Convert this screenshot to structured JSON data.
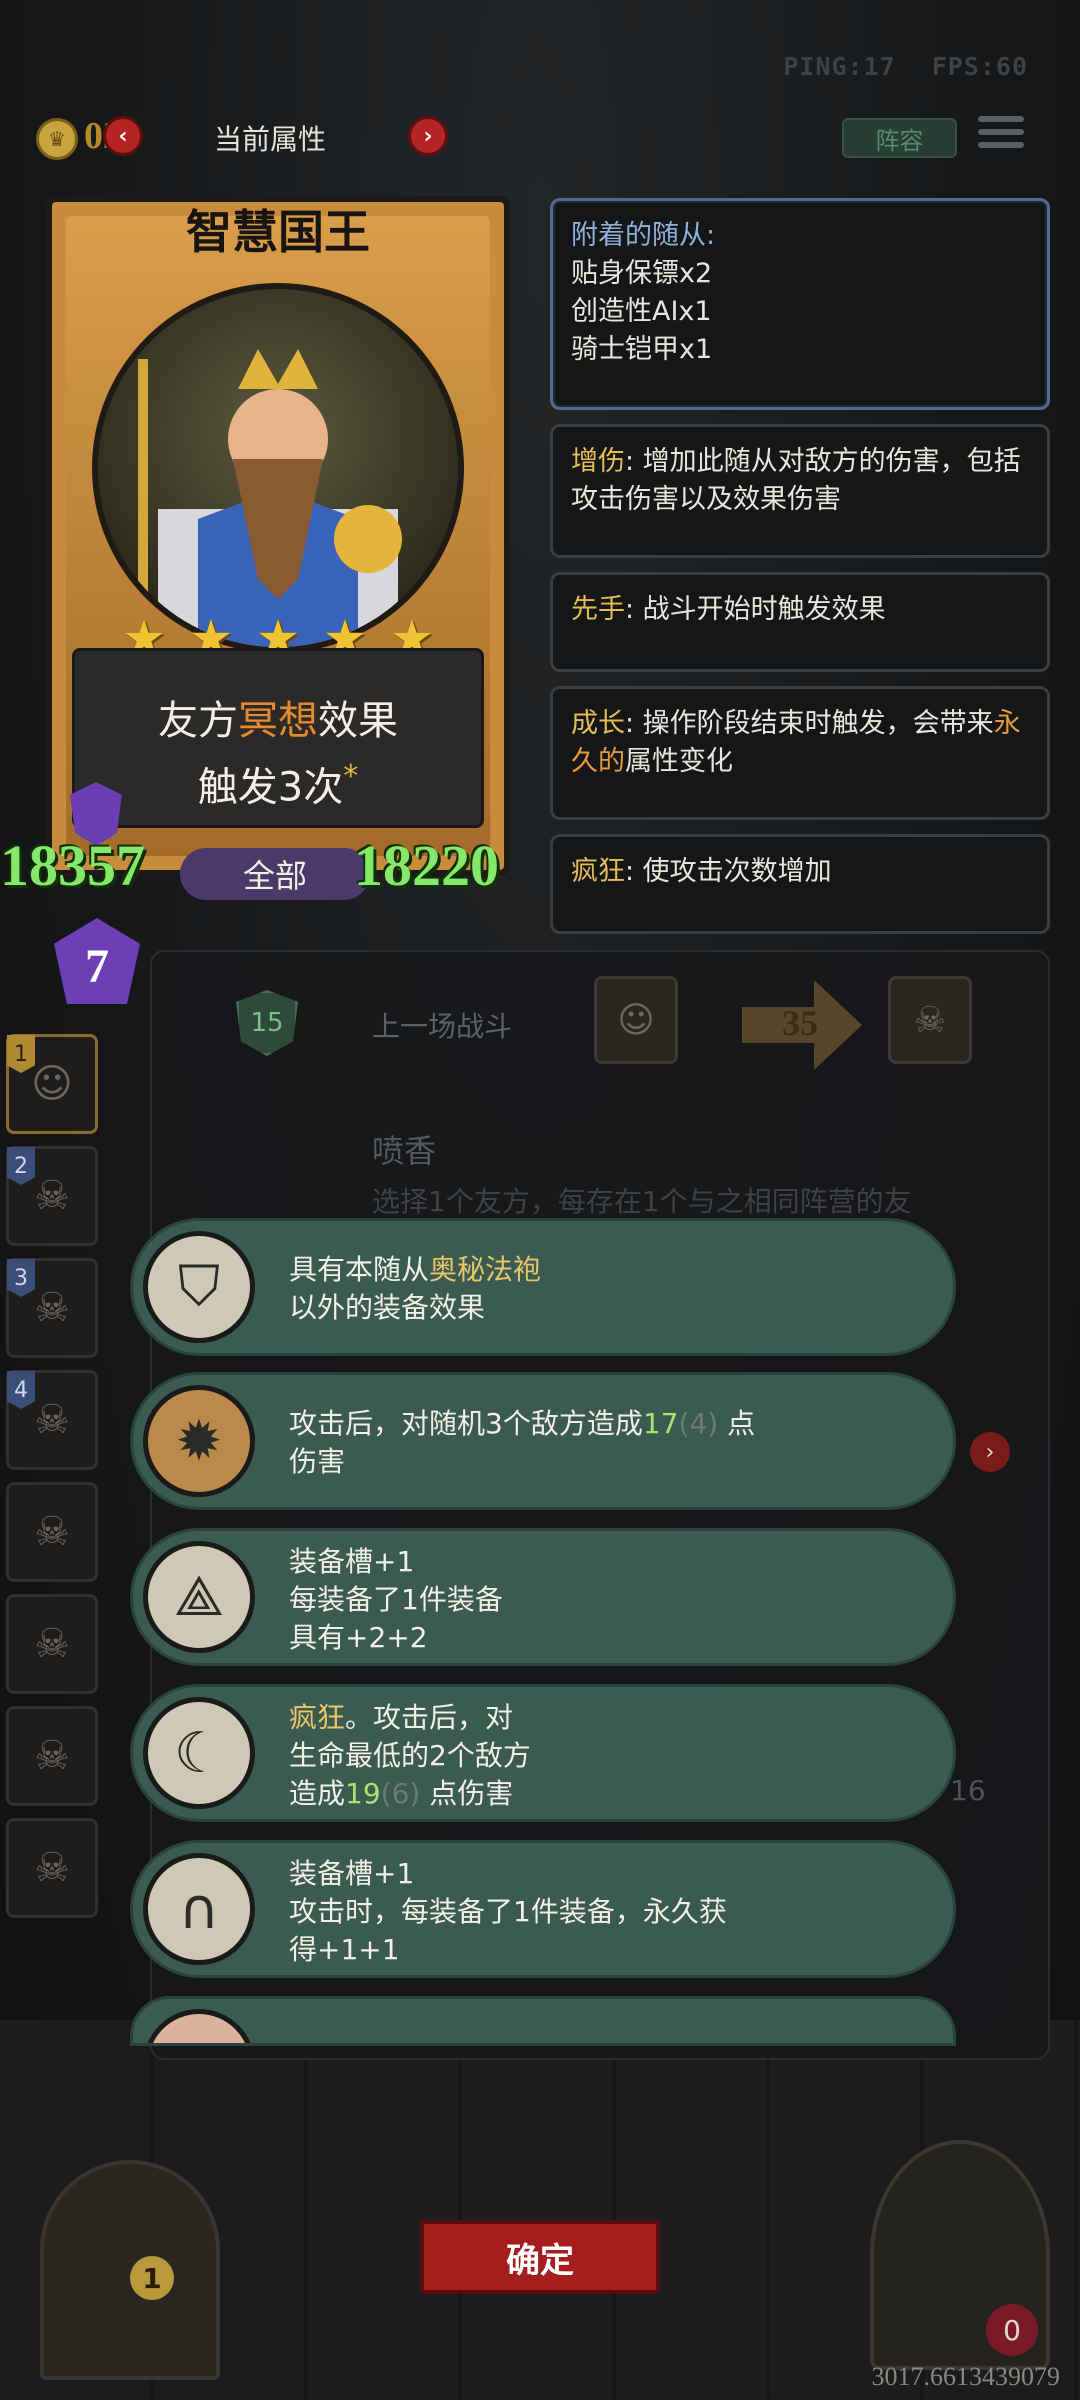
{
  "hud": {
    "ping": "PING:17",
    "fps": "FPS:60",
    "gold": "020",
    "title": "当前属性",
    "lineup_label": "阵容"
  },
  "hero": {
    "name": "智慧国王",
    "stars": 5,
    "effect_line1_a": "友方",
    "effect_line1_hl": "冥想",
    "effect_line1_b": "效果",
    "effect_line2": "触发3次",
    "effect_asterisk": "*",
    "stat_left": "18357",
    "stat_right": "18220",
    "filter_label": "全部",
    "level": "7"
  },
  "tooltips": [
    {
      "title": "附着的随从:",
      "lines": [
        "贴身保镖x2",
        "创造性AIx1",
        "骑士铠甲x1"
      ]
    },
    {
      "key": "增伤",
      "text": ": 增加此随从对敌方的伤害，包括攻击伤害以及效果伤害"
    },
    {
      "key": "先手",
      "text": ": 战斗开始时触发效果"
    },
    {
      "key": "成长",
      "text_a": ": 操作阶段结束时触发，会带来",
      "hl": "永久的",
      "text_b": "属性变化"
    },
    {
      "key": "疯狂",
      "text": ": 使攻击次数增加"
    }
  ],
  "battle": {
    "shield_value": "15",
    "last_battle_label": "上一场战斗",
    "damage": "35",
    "skill_title": "喷香",
    "skill_desc": "选择1个友方，每存在1个与之相同阵营的友"
  },
  "roster_numbers": [
    "1",
    "2",
    "3",
    "4"
  ],
  "equipment": [
    {
      "icon": "robe-icon",
      "line1_a": "具有本随从",
      "line1_hl": "奥秘法袍",
      "line2": "以外的装备效果"
    },
    {
      "icon": "catapult-icon",
      "line1_a": "攻击后，对随机",
      "line1_b": "3",
      "line1_c": "个敌方造成",
      "line1_val": "17",
      "line1_dim": "(4)",
      "line1_d": " 点",
      "line2": "伤害"
    },
    {
      "icon": "spikes-icon",
      "line1": "装备槽+1",
      "line2": "每装备了1件装备",
      "line3": "具有+2+2"
    },
    {
      "icon": "scythe-icon",
      "line1_hl": "疯狂",
      "line1_b": "。攻击后，对",
      "line2": "生命最低的2个敌方",
      "line3_a": "造成",
      "line3_val": "19",
      "line3_dim": "(6)",
      "line3_b": " 点伤害"
    },
    {
      "icon": "horseshoe-icon",
      "line1": "装备槽+1",
      "line2": "攻击时，每装备了1件装备，永久获",
      "line3": "得+1+1"
    }
  ],
  "bottom": {
    "door_count": "1",
    "confirm": "确定",
    "hearts": "0",
    "coords": "3017.6613439079",
    "right_number": "16"
  },
  "colors": {
    "stat_green": "#86e86b",
    "highlight_orange": "#e88a2c",
    "keyword_gold": "#e6bc55",
    "equip_bg": "#3a5a52",
    "confirm_red": "#a51d1d"
  }
}
